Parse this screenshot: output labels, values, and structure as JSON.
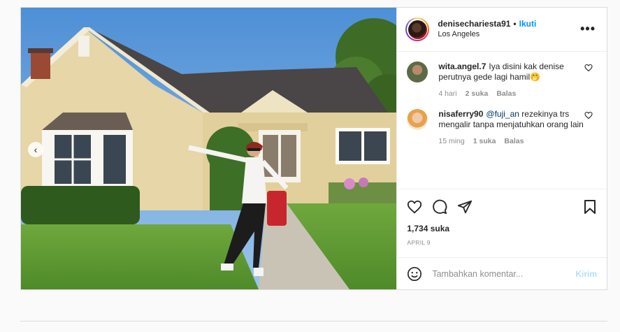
{
  "post": {
    "username": "denisechariesta91",
    "separator": "•",
    "follow_label": "Ikuti",
    "location": "Los Angeles",
    "more_label": "•••"
  },
  "comments": [
    {
      "username": "wita.angel.7",
      "text": "Iya disini kak denise perutnya gede lagi hamil🤭",
      "time": "4 hari",
      "likes": "2 suka",
      "reply": "Balas"
    },
    {
      "username": "nisaferry90",
      "mention": "@fuji_an",
      "text": " rezekinya trs mengalir tanpa menjatuhkan orang lain",
      "time": "15 ming",
      "likes": "1 suka",
      "reply": "Balas"
    }
  ],
  "stats": {
    "likes": "1,734 suka",
    "date": "APRIL 9"
  },
  "composer": {
    "placeholder": "Tambahkan komentar...",
    "send_label": "Kirim"
  },
  "media": {
    "prev_arrow": "‹"
  },
  "colors": {
    "accent": "#0095f6",
    "send_disabled": "#b2dffc",
    "muted": "#8e8e8e"
  }
}
